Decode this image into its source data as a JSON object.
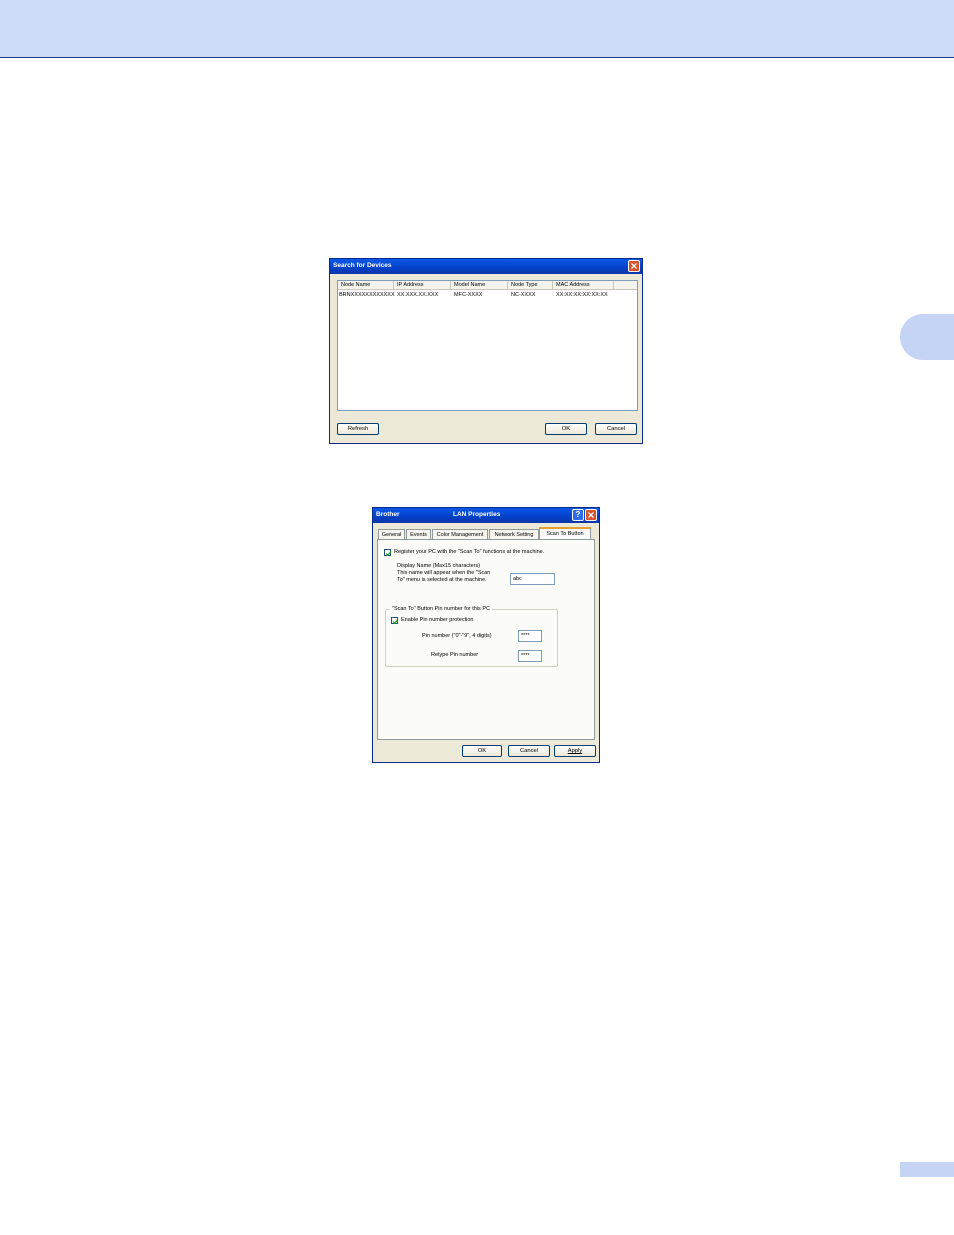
{
  "search_dialog": {
    "title": "Search for Devices",
    "columns": [
      "Node Name",
      "IP Address",
      "Model Name",
      "Node Type",
      "MAC Address"
    ],
    "rows": [
      [
        "BRNXXXXXXXXXXXX",
        "XX.XXX.XX.XXX",
        "MFC-XXXX",
        "NC-XXXX",
        "XX:XX:XX:XX:XX:XX"
      ]
    ],
    "refresh_label": "Refresh",
    "ok_label": "OK",
    "cancel_label": "Cancel"
  },
  "lan_dialog": {
    "title_left": "Brother",
    "title_center": "LAN Properties",
    "help_label": "?",
    "tabs": [
      "General",
      "Events",
      "Color Management",
      "Network Setting",
      "Scan To Button"
    ],
    "active_tab": "Scan To Button",
    "register_label": "Register your PC with the \"Scan To\" functions at the machine.",
    "register_checked": true,
    "display_name_label_1": "Display Name (Max15 characters)",
    "display_name_label_2": "This name will appear when the \"Scan",
    "display_name_label_3": "To\" menu is selected at the machine.",
    "display_name_value": "abc",
    "group_title": "\"Scan To\" Button Pin number for this PC",
    "enable_pin_label": "Enable Pin number protection",
    "enable_pin_checked": true,
    "pin_label": "Pin number (\"0\"-\"9\", 4 digits)",
    "pin_value": "****",
    "retype_pin_label": "Retype Pin number",
    "retype_pin_value": "****",
    "ok_label": "OK",
    "cancel_label": "Cancel",
    "apply_label": "Apply"
  }
}
